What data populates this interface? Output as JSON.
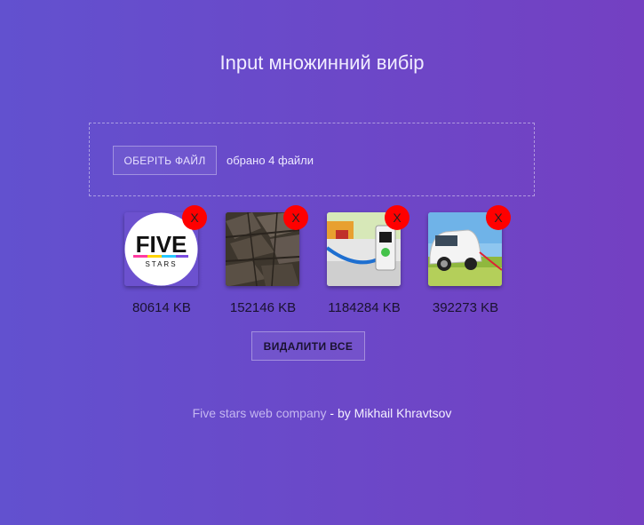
{
  "title": "Input множинний вибір",
  "picker": {
    "button_label": "ОБЕРІТЬ ФАЙЛ",
    "status": "обрано 4 файли"
  },
  "files": [
    {
      "size": "80614 KB",
      "remove_label": "X",
      "logo_word": "FIVE",
      "logo_sub": "STARS"
    },
    {
      "size": "152146 KB",
      "remove_label": "X"
    },
    {
      "size": "1184284 KB",
      "remove_label": "X"
    },
    {
      "size": "392273 KB",
      "remove_label": "X"
    }
  ],
  "delete_all_label": "ВИДАЛИТИ ВСЕ",
  "footer": {
    "company": "Five stars web company",
    "separator": " - ",
    "author": "by Mikhail Khravtsov"
  },
  "colors": {
    "remove_bg": "#ff0000",
    "bg_start": "#6251cf",
    "bg_end": "#7440c2"
  }
}
